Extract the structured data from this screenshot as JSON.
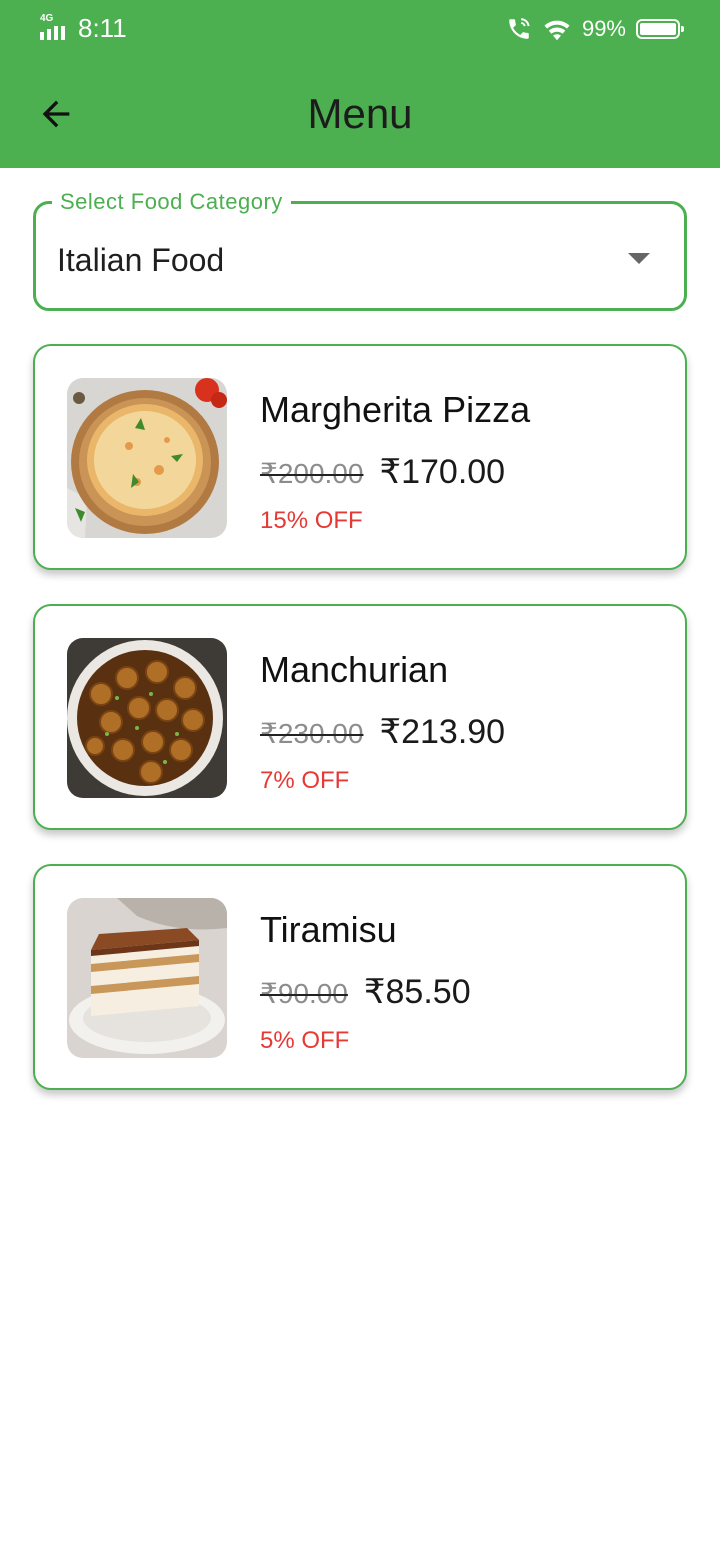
{
  "status_bar": {
    "network": "4G",
    "time": "8:11",
    "battery": "99%"
  },
  "header": {
    "title": "Menu"
  },
  "category": {
    "label": "Select Food Category",
    "value": "Italian Food"
  },
  "items": [
    {
      "name": "Margherita Pizza",
      "original_price": "₹200.00",
      "price": "₹170.00",
      "discount": "15% OFF"
    },
    {
      "name": "Manchurian",
      "original_price": "₹230.00",
      "price": "₹213.90",
      "discount": "7% OFF"
    },
    {
      "name": "Tiramisu",
      "original_price": "₹90.00",
      "price": "₹85.50",
      "discount": "5% OFF"
    }
  ],
  "colors": {
    "primary": "#4caf50",
    "discount": "#e53935"
  }
}
